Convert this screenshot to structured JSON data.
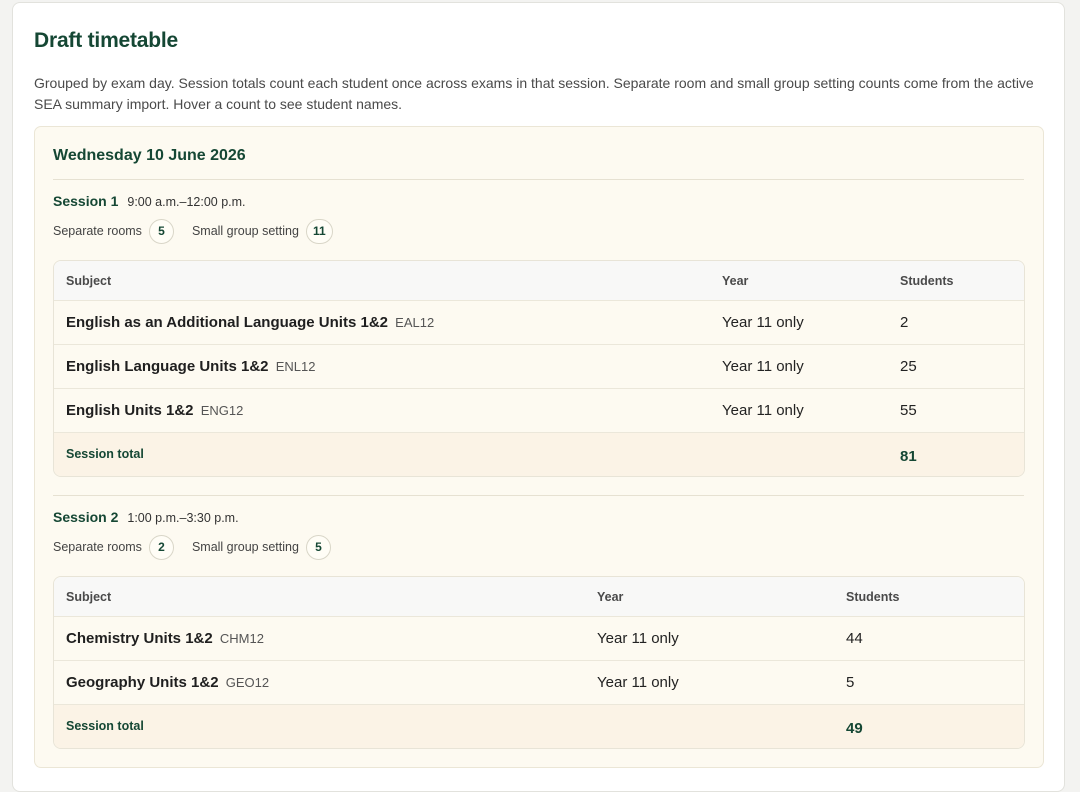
{
  "page": {
    "title": "Draft timetable",
    "intro": "Grouped by exam day. Session totals count each student once across exams in that session. Separate room and small group setting counts come from the active SEA summary import. Hover a count to see student names."
  },
  "days": [
    {
      "title": "Wednesday 10 June 2026",
      "sessions": [
        {
          "label": "Session 1",
          "time": "9:00 a.m.–12:00 p.m.",
          "separate_rooms_label": "Separate rooms",
          "separate_rooms": "5",
          "small_group_label": "Small group setting",
          "small_group": "11",
          "headers": {
            "subject": "Subject",
            "year": "Year",
            "students": "Students"
          },
          "rows": [
            {
              "subject": "English as an Additional Language Units 1&2",
              "code": "EAL12",
              "year": "Year 11 only",
              "students": "2"
            },
            {
              "subject": "English Language Units 1&2",
              "code": "ENL12",
              "year": "Year 11 only",
              "students": "25"
            },
            {
              "subject": "English Units 1&2",
              "code": "ENG12",
              "year": "Year 11 only",
              "students": "55"
            }
          ],
          "total_label": "Session total",
          "total": "81"
        },
        {
          "label": "Session 2",
          "time": "1:00 p.m.–3:30 p.m.",
          "separate_rooms_label": "Separate rooms",
          "separate_rooms": "2",
          "small_group_label": "Small group setting",
          "small_group": "5",
          "headers": {
            "subject": "Subject",
            "year": "Year",
            "students": "Students"
          },
          "rows": [
            {
              "subject": "Chemistry Units 1&2",
              "code": "CHM12",
              "year": "Year 11 only",
              "students": "44"
            },
            {
              "subject": "Geography Units 1&2",
              "code": "GEO12",
              "year": "Year 11 only",
              "students": "5"
            }
          ],
          "total_label": "Session total",
          "total": "49"
        }
      ]
    }
  ]
}
